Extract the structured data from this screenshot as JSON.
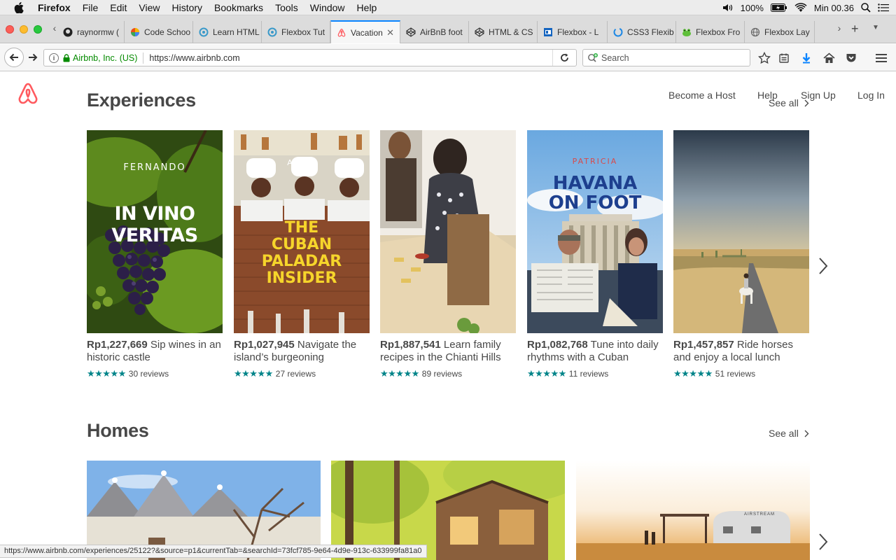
{
  "menubar": {
    "app": "Firefox",
    "items": [
      "File",
      "Edit",
      "View",
      "History",
      "Bookmarks",
      "Tools",
      "Window",
      "Help"
    ],
    "battery": "100%",
    "clock": "Min 00.36"
  },
  "tabs": [
    {
      "label": "raynormw (",
      "icon": "github-icon"
    },
    {
      "label": "Code Schoo",
      "icon": "codeschool-icon"
    },
    {
      "label": "Learn HTML",
      "icon": "codecademy-icon"
    },
    {
      "label": "Flexbox Tut",
      "icon": "codecademy-icon"
    },
    {
      "label": "Vacation",
      "icon": "airbnb-icon",
      "active": true
    },
    {
      "label": "AirBnB foot",
      "icon": "codepen-icon"
    },
    {
      "label": "HTML & CS",
      "icon": "codepen-icon"
    },
    {
      "label": "Flexbox - L",
      "icon": "flexbox-icon"
    },
    {
      "label": "CSS3 Flexib",
      "icon": "w3-icon"
    },
    {
      "label": "Flexbox Fro",
      "icon": "froggy-icon"
    },
    {
      "label": "Flexbox Lay",
      "icon": "globe-icon"
    }
  ],
  "navbar": {
    "identity": "Airbnb, Inc. (US)",
    "url": "https://www.airbnb.com",
    "search_placeholder": "Search"
  },
  "header": {
    "nav": [
      "Become a Host",
      "Help",
      "Sign Up",
      "Log In"
    ]
  },
  "experiences": {
    "title": "Experiences",
    "see_all": "See all",
    "cards": [
      {
        "host": "FERNANDO",
        "headline": "IN VINO VERITAS",
        "price": "Rp1,227,669",
        "text": "Sip wines in an historic castle",
        "stars": "★★★★★",
        "reviews": "30 reviews"
      },
      {
        "host": "ARIEL",
        "headline": "THE CUBAN PALADAR INSIDER",
        "price": "Rp1,027,945",
        "text": "Navigate the island’s burgeoning",
        "stars": "★★★★★",
        "reviews": "27 reviews"
      },
      {
        "host": "",
        "headline": "",
        "price": "Rp1,887,541",
        "text": "Learn family recipes in the Chianti Hills",
        "stars": "★★★★★",
        "reviews": "89 reviews"
      },
      {
        "host": "PATRICIA",
        "headline": "HAVANA ON FOOT",
        "price": "Rp1,082,768",
        "text": "Tune into daily rhythms with a Cuban",
        "stars": "★★★★★",
        "reviews": "11 reviews"
      },
      {
        "host": "",
        "headline": "",
        "price": "Rp1,457,857",
        "text": "Ride horses and enjoy a local lunch",
        "stars": "★★★★★",
        "reviews": "51 reviews"
      }
    ]
  },
  "homes": {
    "title": "Homes",
    "see_all": "See all",
    "airstream_label": "AIRSTREAM"
  },
  "status_url": "https://www.airbnb.com/experiences/25122?&source=p1&currentTab=&searchId=73fcf785-9e64-4d9e-913c-633999fa81a0",
  "colors": {
    "brand": "#ff5a5f",
    "stars": "#008489",
    "text": "#484848",
    "firefox_blue": "#0a84ff"
  }
}
